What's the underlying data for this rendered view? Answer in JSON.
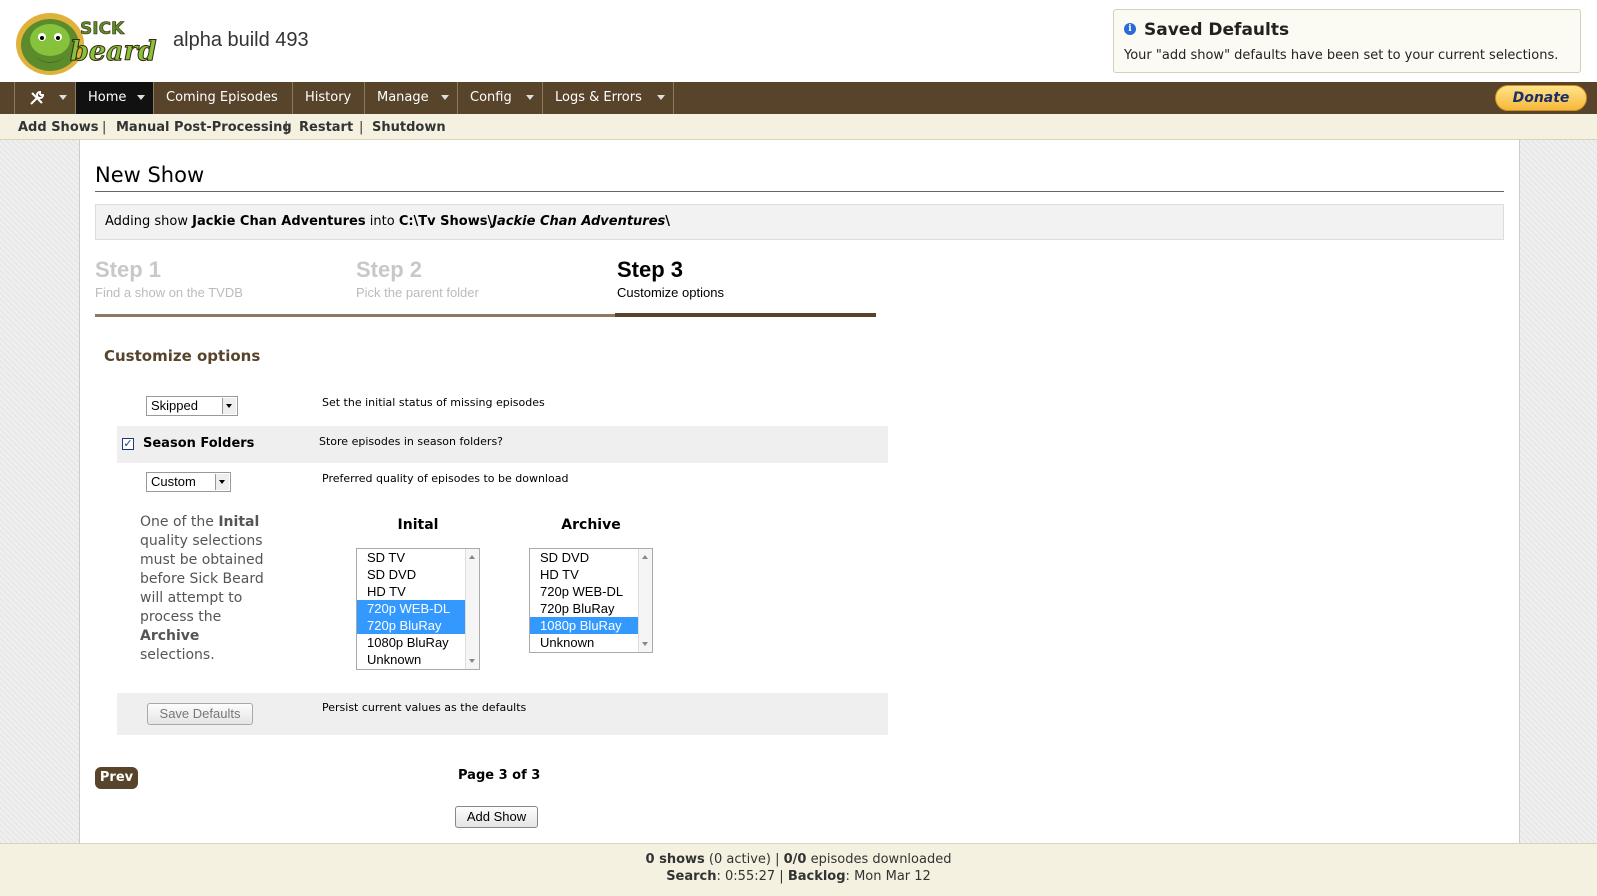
{
  "header": {
    "logo_text": "SICK beard",
    "version": "alpha build 493"
  },
  "notification": {
    "icon": "info-icon",
    "title": "Saved Defaults",
    "message": "Your \"add show\" defaults have been set to your current selections."
  },
  "nav": {
    "tools_icon": "wrench-icon",
    "items": [
      {
        "label": "Home",
        "active": true,
        "dropdown": true
      },
      {
        "label": "Coming Episodes",
        "dropdown": false
      },
      {
        "label": "History",
        "dropdown": false
      },
      {
        "label": "Manage",
        "dropdown": true
      },
      {
        "label": "Config",
        "dropdown": true
      },
      {
        "label": "Logs & Errors",
        "dropdown": true
      }
    ],
    "donate_label": "Donate"
  },
  "subnav": {
    "items": [
      "Add Shows",
      "Manual Post-Processing",
      "Restart",
      "Shutdown"
    ],
    "separator": "|"
  },
  "page": {
    "title": "New Show",
    "adding": {
      "prefix": "Adding show",
      "show_name": "Jackie Chan Adventures",
      "into": "into",
      "path_base": "C:\\Tv Shows\\",
      "path_show": "Jackie Chan Adventures",
      "path_end": "\\"
    },
    "steps": [
      {
        "title": "Step 1",
        "subtitle": "Find a show on the TVDB"
      },
      {
        "title": "Step 2",
        "subtitle": "Pick the parent folder"
      },
      {
        "title": "Step 3",
        "subtitle": "Customize options",
        "current": true
      }
    ],
    "section_heading": "Customize options"
  },
  "options": {
    "status": {
      "value": "Skipped",
      "description": "Set the initial status of missing episodes"
    },
    "season_folders": {
      "label": "Season Folders",
      "checked": true,
      "description": "Store episodes in season folders?"
    },
    "quality": {
      "value": "Custom",
      "description": "Preferred quality of episodes to be download"
    },
    "quality_help": {
      "part1": "One of the",
      "initial_word": "Inital",
      "part2": "quality selections must be obtained before Sick Beard will attempt to process the",
      "archive_word": "Archive",
      "part3": "selections."
    },
    "initial_list": {
      "title": "Inital",
      "options": [
        {
          "label": "SD TV",
          "selected": false
        },
        {
          "label": "SD DVD",
          "selected": false
        },
        {
          "label": "HD TV",
          "selected": false
        },
        {
          "label": "720p WEB-DL",
          "selected": true
        },
        {
          "label": "720p BluRay",
          "selected": true
        },
        {
          "label": "1080p BluRay",
          "selected": false
        },
        {
          "label": "Unknown",
          "selected": false
        }
      ]
    },
    "archive_list": {
      "title": "Archive",
      "options": [
        {
          "label": "SD DVD",
          "selected": false
        },
        {
          "label": "HD TV",
          "selected": false
        },
        {
          "label": "720p WEB-DL",
          "selected": false
        },
        {
          "label": "720p BluRay",
          "selected": false
        },
        {
          "label": "1080p BluRay",
          "selected": true
        },
        {
          "label": "Unknown",
          "selected": false
        }
      ]
    },
    "save_defaults": {
      "label": "Save Defaults",
      "description": "Persist current values as the defaults"
    }
  },
  "pager": {
    "prev_label": "Prev",
    "page_text": "Page 3 of 3",
    "add_show_label": "Add Show"
  },
  "footer": {
    "shows_count": "0 shows",
    "active": "(0 active)",
    "episodes": "0/0",
    "episodes_label": "episodes downloaded",
    "search_label": "Search",
    "search_value": "0:55:27",
    "backlog_label": "Backlog",
    "backlog_value": "Mon Mar 12"
  },
  "colors": {
    "nav_bg": "#57442b",
    "subnav_bg": "#f4f1e1",
    "selection": "#3399ff",
    "heading": "#57442b"
  }
}
